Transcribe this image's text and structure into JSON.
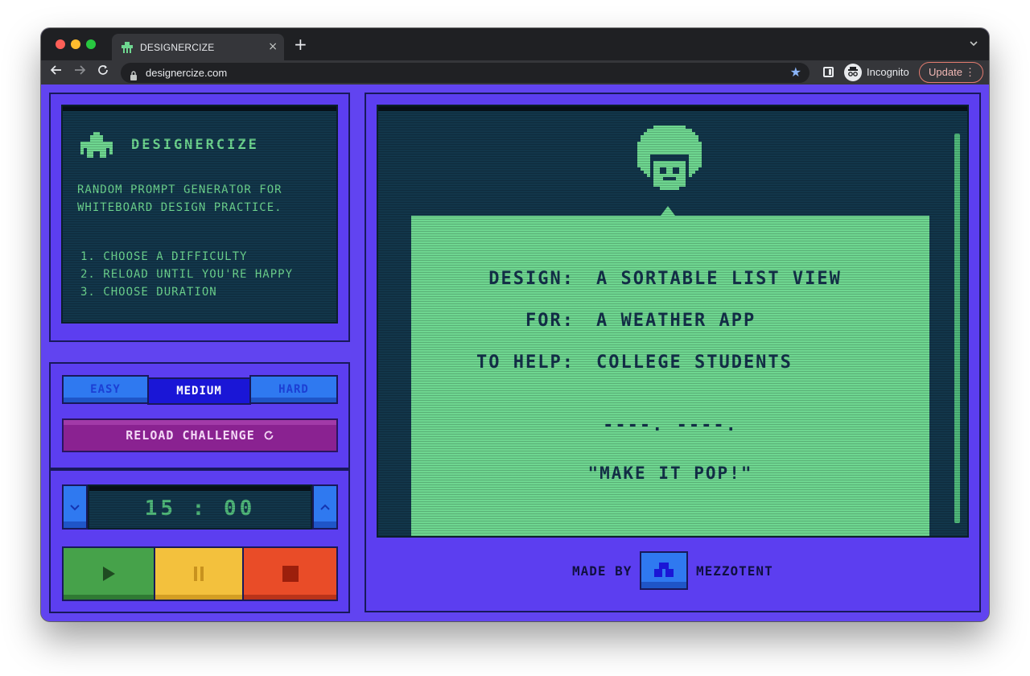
{
  "browser": {
    "tab_title": "DESIGNERCIZE",
    "tab_close": "×",
    "new_tab": "+",
    "url": "designercize.com",
    "incognito_label": "Incognito",
    "update_label": "Update"
  },
  "info": {
    "title": "DESIGNERCIZE",
    "description": "RANDOM PROMPT GENERATOR FOR WHITEBOARD DESIGN PRACTICE.",
    "steps": [
      "1. CHOOSE A DIFFICULTY",
      "2. RELOAD UNTIL YOU'RE HAPPY",
      "3. CHOOSE DURATION"
    ]
  },
  "difficulty": {
    "options": [
      "EASY",
      "MEDIUM",
      "HARD"
    ],
    "selected": "MEDIUM"
  },
  "reload_label": "RELOAD CHALLENGE",
  "timer": {
    "display": "15 : 00"
  },
  "prompt": {
    "rows": [
      {
        "label": "DESIGN:",
        "value": "A SORTABLE LIST VIEW"
      },
      {
        "label": "FOR:",
        "value": "A WEATHER APP"
      },
      {
        "label": "TO HELP:",
        "value": "COLLEGE STUDENTS"
      }
    ],
    "dashes": "----. ----.",
    "quote": "\"MAKE IT POP!\""
  },
  "footer": {
    "made_by": "MADE BY",
    "author": "MEZZOTENT"
  },
  "colors": {
    "background": "#6144f0",
    "screen": "#12364a",
    "screen_text": "#6ed690",
    "play": "#46a24a",
    "pause": "#f3c13d",
    "stop": "#e94c28",
    "reload": "#8a2291",
    "button_blue": "#2f79f0"
  }
}
